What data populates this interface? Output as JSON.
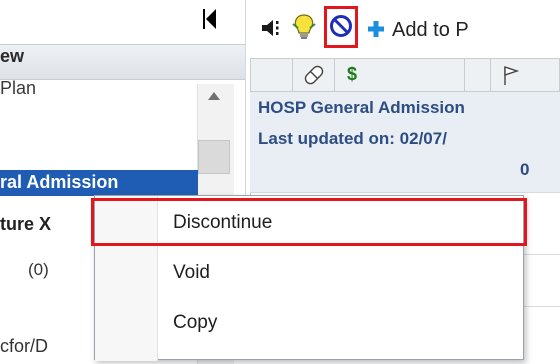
{
  "left_panel": {
    "section_title": "ew",
    "item_plan": "Plan",
    "selected_item": "ral Admission",
    "item_ture": "ture X",
    "item_count": "(0)",
    "item_bottom": "cfor/D"
  },
  "toolbar": {
    "add_to_label": "Add to P",
    "icons": [
      "collapse-icon",
      "communicate-icon",
      "lightbulb-icon",
      "discontinue-icon",
      "plus-icon"
    ]
  },
  "grid": {
    "header_icons": [
      "pill-icon",
      "dollar-icon",
      "flag-icon"
    ],
    "dollar_symbol": "$",
    "line1": "HOSP General Admission",
    "line2": "Last updated on: 02/07/",
    "line3": "0"
  },
  "context_menu": {
    "items": [
      {
        "label": "Discontinue"
      },
      {
        "label": "Void"
      },
      {
        "label": "Copy"
      }
    ]
  },
  "colors": {
    "highlight": "#e2161d",
    "selection": "#1f5db5",
    "link_text": "#2d4d83",
    "add_plus": "#1b8ee0"
  }
}
